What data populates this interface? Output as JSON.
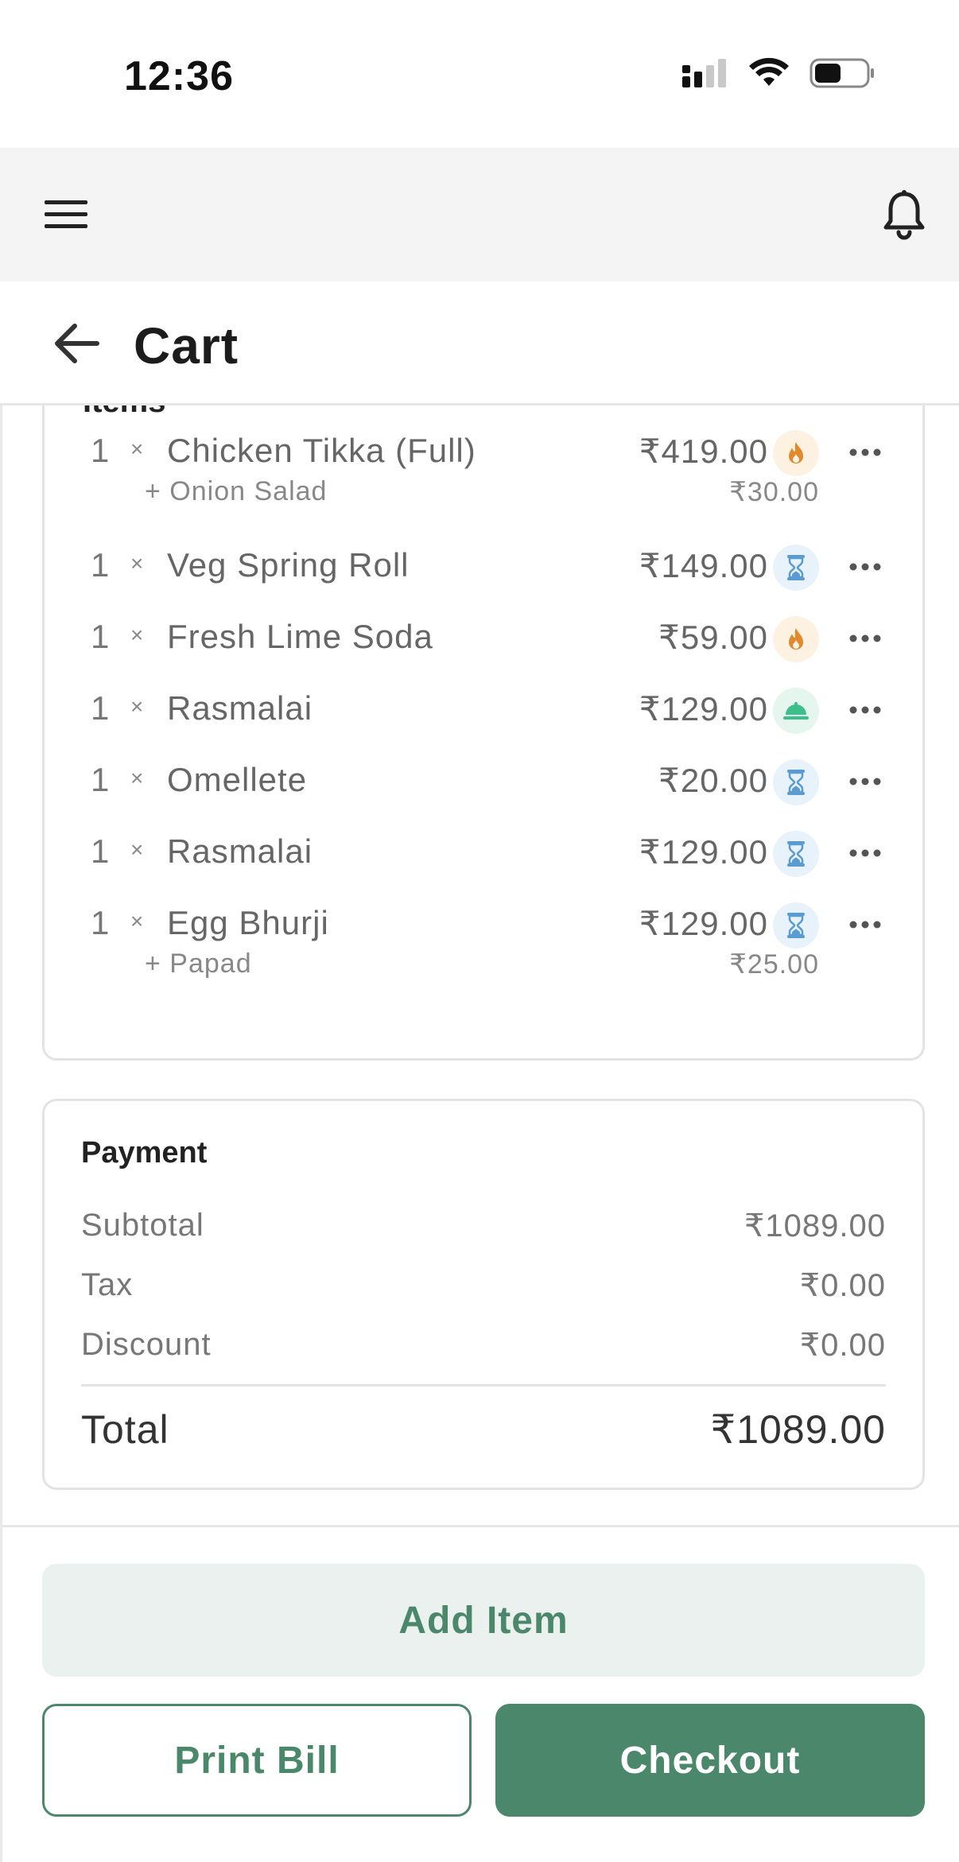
{
  "status_bar": {
    "time": "12:36"
  },
  "header": {
    "title": "Cart"
  },
  "items_section": {
    "heading": "Items",
    "items": [
      {
        "qty": "1",
        "times": "×",
        "name": "Chicken Tikka (Full)",
        "price": "₹419.00",
        "status_icon": "fire-icon",
        "addon": {
          "name": "+ Onion Salad",
          "price": "₹30.00"
        }
      },
      {
        "qty": "1",
        "times": "×",
        "name": "Veg Spring Roll",
        "price": "₹149.00",
        "status_icon": "hourglass-icon"
      },
      {
        "qty": "1",
        "times": "×",
        "name": "Fresh Lime Soda",
        "price": "₹59.00",
        "status_icon": "fire-icon"
      },
      {
        "qty": "1",
        "times": "×",
        "name": "Rasmalai",
        "price": "₹129.00",
        "status_icon": "served-cloche-icon"
      },
      {
        "qty": "1",
        "times": "×",
        "name": "Omellete",
        "price": "₹20.00",
        "status_icon": "hourglass-icon"
      },
      {
        "qty": "1",
        "times": "×",
        "name": "Rasmalai",
        "price": "₹129.00",
        "status_icon": "hourglass-icon"
      },
      {
        "qty": "1",
        "times": "×",
        "name": "Egg Bhurji",
        "price": "₹129.00",
        "status_icon": "hourglass-icon",
        "addon": {
          "name": "+ Papad",
          "price": "₹25.00"
        }
      }
    ]
  },
  "payment": {
    "heading": "Payment",
    "subtotal_label": "Subtotal",
    "subtotal_value": "₹1089.00",
    "tax_label": "Tax",
    "tax_value": "₹0.00",
    "discount_label": "Discount",
    "discount_value": "₹0.00",
    "total_label": "Total",
    "total_value": "₹1089.00"
  },
  "actions": {
    "add_item": "Add Item",
    "print_bill": "Print Bill",
    "checkout": "Checkout"
  },
  "colors": {
    "accent": "#4a876b",
    "accent_light": "#ebf1ef",
    "fire": "#e08a2c",
    "hourglass": "#5a9bd0",
    "served": "#3cbf8a"
  }
}
